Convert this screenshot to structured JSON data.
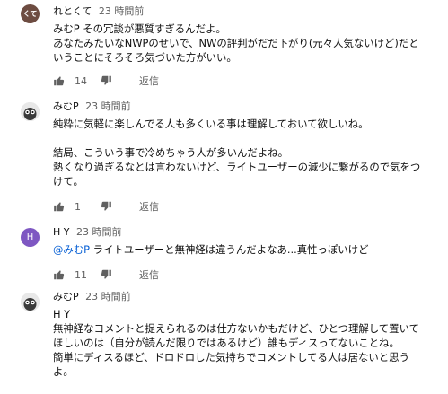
{
  "comments": [
    {
      "avatar_text": "くて",
      "author": "れとくて",
      "time": "23 時間前",
      "lines": [
        "みむP その冗談が悪質すぎるんだよ。",
        "あなたみたいなNWPのせいで、NWの評判がだだ下がり(元々人気ないけど)だと",
        "いうことにそろそろ気づいた方がいい。"
      ],
      "likes": "14",
      "reply_label": "返信"
    },
    {
      "author": "みむP",
      "time": "23 時間前",
      "lines": [
        "純粋に気軽に楽しんでる人も多くいる事は理解しておいて欲しいね。",
        "",
        "結局、こういう事で冷めちゃう人が多いんだよね。",
        "熱くなり過ぎるなとは言わないけど、ライトユーザーの減少に繋がるので気をつ",
        "けて。"
      ],
      "likes": "1",
      "reply_label": "返信"
    },
    {
      "avatar_letter": "H",
      "author": "H Y",
      "time": "23 時間前",
      "mention": "@みむP",
      "text": " ライトユーザーと無神経は違うんだよなあ...真性っぽいけど",
      "likes": "11",
      "reply_label": "返信"
    },
    {
      "author": "みむP",
      "time": "23 時間前",
      "lines": [
        "H Y",
        "無神経なコメントと捉えられるのは仕方ないかもだけど、ひとつ理解して置いて",
        "ほしいのは（自分が読んだ限りではあるけど）誰もディスってないことね。",
        "簡単にディスるほど、ドロドロした気持ちでコメントしてる人は居ないと思う",
        "よ。"
      ]
    }
  ],
  "colors": {
    "link": "#065fd4",
    "meta": "#606060",
    "text": "#0f0f0f"
  },
  "icons": {
    "like": "thumbs-up-icon",
    "dislike": "thumbs-down-icon"
  }
}
